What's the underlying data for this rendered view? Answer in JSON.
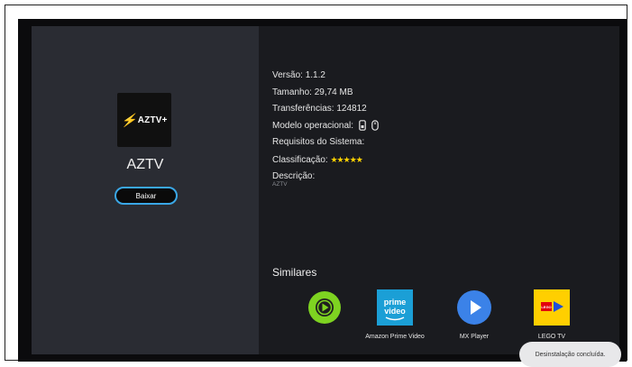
{
  "app": {
    "name": "AZTV",
    "logo_text": "AZTV+",
    "download_label": "Baixar"
  },
  "info": {
    "version_key": "Versão:",
    "version_val": "1.1.2",
    "size_key": "Tamanho:",
    "size_val": "29,74 MB",
    "downloads_key": "Transferências:",
    "downloads_val": "124812",
    "os_key": "Modelo operacional:",
    "requirements_key": "Requisitos do Sistema:",
    "rating_key": "Classificação:",
    "rating_stars": 5,
    "rating_symbol": "★★★★★",
    "description_key": "Descrição:",
    "description_val": "AZTV"
  },
  "similares": {
    "title": "Similares",
    "items": [
      {
        "label": "",
        "icon": "green-play-icon"
      },
      {
        "label": "Amazon Prime Video",
        "icon": "prime-video-icon",
        "icon_text_1": "prime",
        "icon_text_2": "video"
      },
      {
        "label": "MX Player",
        "icon": "mx-player-icon"
      },
      {
        "label": "LEGO TV",
        "icon": "lego-tv-icon",
        "icon_text": "LEGO"
      }
    ]
  },
  "toast": {
    "text": "Desinstalação concluída."
  },
  "colors": {
    "accent": "#3aa7e6",
    "star": "#ffd400",
    "bolt": "#ff7a1a"
  }
}
